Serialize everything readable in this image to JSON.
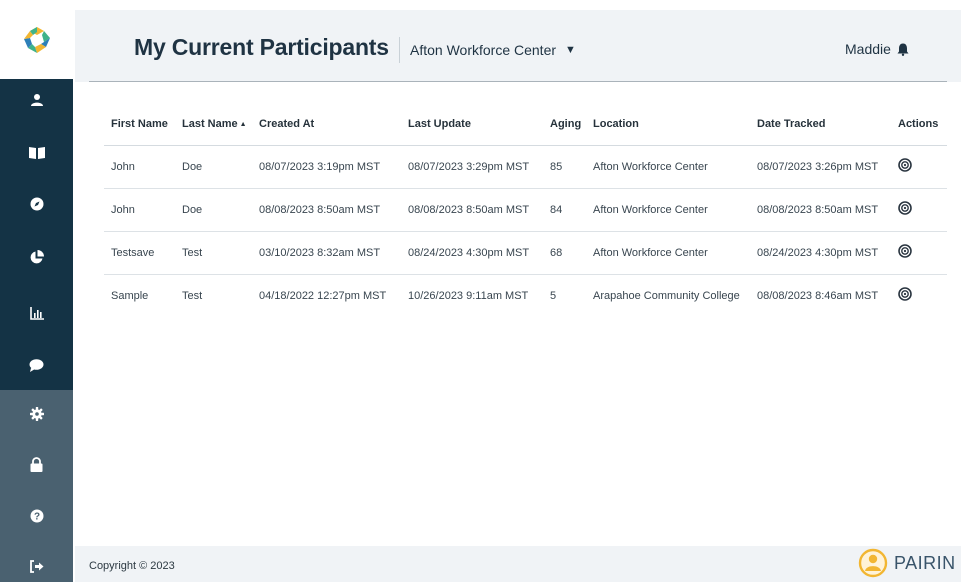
{
  "header": {
    "title": "My Current Participants",
    "location_selected": "Afton Workforce Center",
    "user_name": "Maddie"
  },
  "sidebar": {
    "items": [
      {
        "name": "participants",
        "icon": "user-icon"
      },
      {
        "name": "library",
        "icon": "book-open-icon"
      },
      {
        "name": "explore",
        "icon": "compass-icon"
      },
      {
        "name": "analytics",
        "icon": "pie-chart-icon"
      },
      {
        "name": "reports",
        "icon": "bar-chart-icon"
      },
      {
        "name": "messages",
        "icon": "chat-bubble-icon"
      },
      {
        "name": "settings",
        "icon": "gear-icon"
      },
      {
        "name": "security",
        "icon": "lock-icon"
      },
      {
        "name": "help",
        "icon": "question-icon"
      },
      {
        "name": "logout",
        "icon": "sign-out-icon"
      }
    ]
  },
  "table": {
    "columns": [
      "First Name",
      "Last Name",
      "Created At",
      "Last Update",
      "Aging",
      "Location",
      "Date Tracked",
      "Actions"
    ],
    "sorted_column": "Last Name",
    "rows": [
      {
        "first": "John",
        "last": "Doe",
        "created": "08/07/2023 3:19pm MST",
        "updated": "08/07/2023 3:29pm MST",
        "aging": "85",
        "location": "Afton Workforce Center",
        "tracked": "08/07/2023 3:26pm MST"
      },
      {
        "first": "John",
        "last": "Doe",
        "created": "08/08/2023 8:50am MST",
        "updated": "08/08/2023 8:50am MST",
        "aging": "84",
        "location": "Afton Workforce Center",
        "tracked": "08/08/2023 8:50am MST"
      },
      {
        "first": "Testsave",
        "last": "Test",
        "created": "03/10/2023 8:32am MST",
        "updated": "08/24/2023 4:30pm MST",
        "aging": "68",
        "location": "Afton Workforce Center",
        "tracked": "08/24/2023 4:30pm MST"
      },
      {
        "first": "Sample",
        "last": "Test",
        "created": "04/18/2022 12:27pm MST",
        "updated": "10/26/2023 9:11am MST",
        "aging": "5",
        "location": "Arapahoe Community College",
        "tracked": "08/08/2023 8:46am MST"
      }
    ]
  },
  "footer": {
    "copyright": "Copyright © 2023",
    "brand": "PAIRIN"
  },
  "colors": {
    "sidebar_dark": "#143345",
    "sidebar_light": "#4a6170",
    "header_bg": "#f0f3f6",
    "brand_gold": "#f2b632"
  }
}
